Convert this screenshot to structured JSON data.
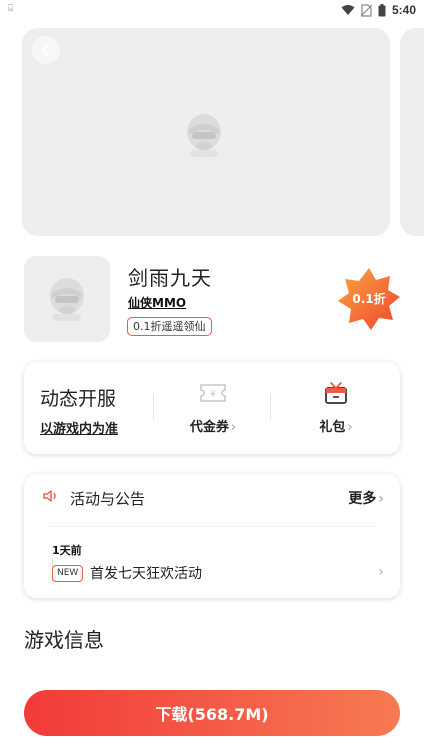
{
  "status_bar": {
    "sim_indicator": "⌸",
    "time": "5:40",
    "icons": [
      "wifi-icon",
      "no-sim-icon",
      "battery-icon"
    ]
  },
  "banner": {
    "back_icon": "chevron-left-icon",
    "placeholder_icon": "placeholder-face-icon"
  },
  "game": {
    "title": "剑雨九天",
    "tag": "仙侠MMO",
    "discount_chip": "0.1折遥遥领仙",
    "badge": "0.1折"
  },
  "server_card": {
    "title": "动态开服",
    "subtitle": "以游戏内为准",
    "voucher_label": "代金券",
    "gift_label": "礼包",
    "chevron": "›",
    "voucher_icon": "voucher-icon",
    "gift_icon": "gift-box-icon"
  },
  "news_card": {
    "title": "活动与公告",
    "more": "更多",
    "chevron": "›",
    "items": [
      {
        "time": "1天前",
        "badge": "NEW",
        "text": "首发七天狂欢活动"
      }
    ]
  },
  "section": {
    "game_info": "游戏信息"
  },
  "download": {
    "label": "下载(568.7M)"
  },
  "colors": {
    "accent": "#f05a44",
    "button_start": "#f23a3a",
    "button_end": "#f77a52",
    "placeholder": "#eeeeee"
  }
}
